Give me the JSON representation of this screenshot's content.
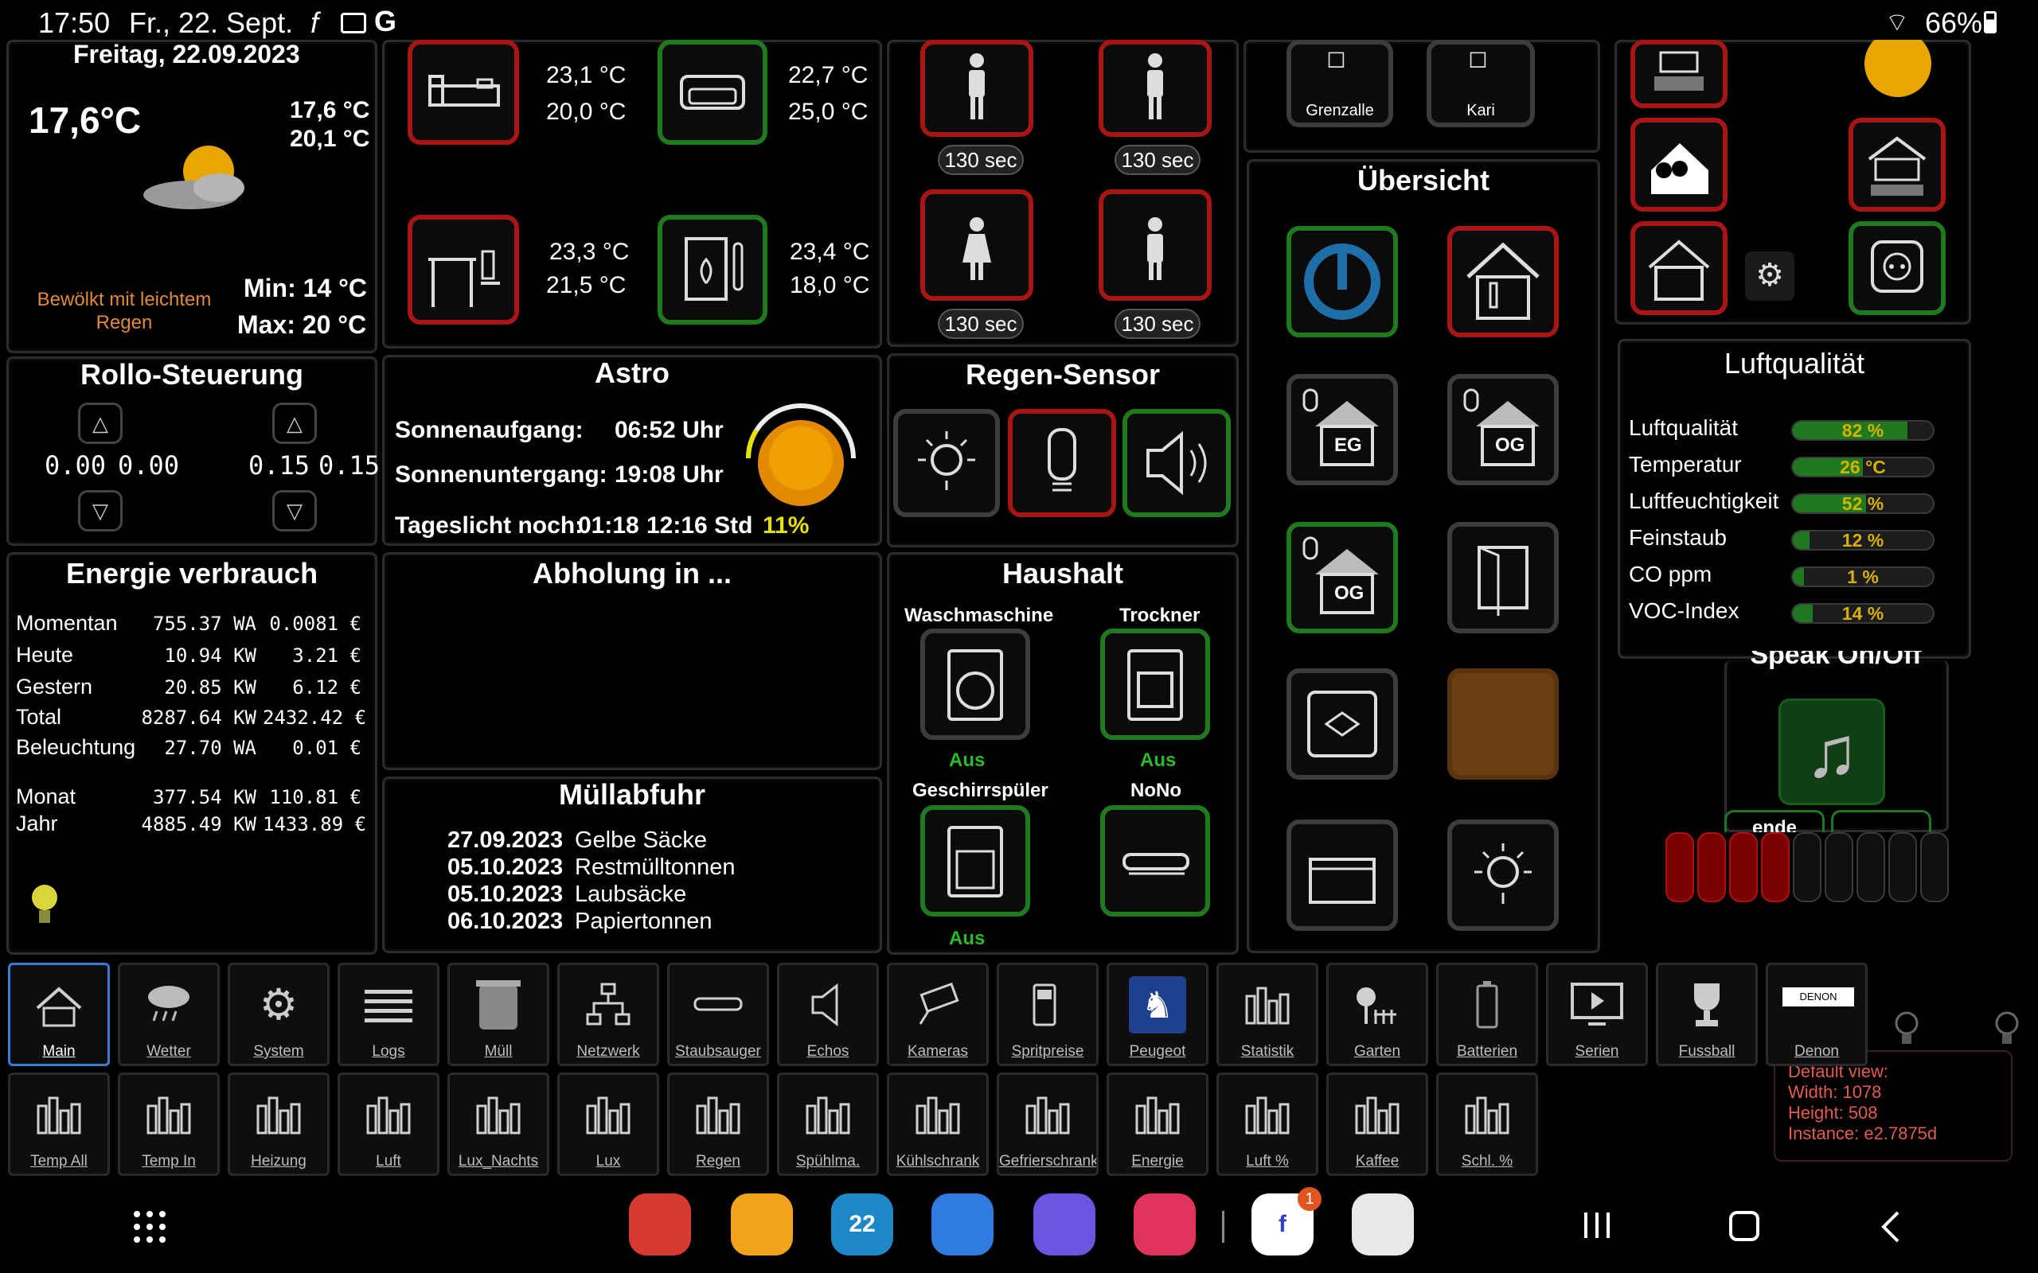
{
  "status_bar": {
    "time": "17:50",
    "date": "Fr., 22. Sept.",
    "battery": "66%",
    "icons": [
      "f-icon",
      "gallery-icon",
      "google-icon"
    ]
  },
  "weather": {
    "date": "Freitag, 22.09.2023",
    "temp_now": "17,6°C",
    "temp_a": "17,6 °C",
    "temp_b": "20,1 °C",
    "desc": "Bewölkt mit leichtem Regen",
    "min": "Min: 14 °C",
    "max": "Max: 20 °C"
  },
  "rooms": [
    {
      "icon": "bed-icon",
      "t1": "23,1 °C",
      "t2": "20,0 °C",
      "status": "red"
    },
    {
      "icon": "sofa-icon",
      "t1": "22,7 °C",
      "t2": "25,0 °C",
      "status": "green"
    },
    {
      "icon": "desk-icon",
      "t1": "23,3 °C",
      "t2": "21,5 °C",
      "status": "red"
    },
    {
      "icon": "heater-icon",
      "t1": "23,4 °C",
      "t2": "18,0 °C",
      "status": "green"
    }
  ],
  "presence": {
    "labels": [
      "130 sec",
      "130 sec",
      "130 sec",
      "130 sec"
    ]
  },
  "messages": {
    "items": [
      "Grenzalle",
      "Kari"
    ]
  },
  "rollo": {
    "title": "Rollo-Steuerung",
    "left": [
      "0.00",
      "0.00"
    ],
    "right": [
      "0.15",
      "0.15"
    ]
  },
  "astro": {
    "title": "Astro",
    "sunrise_label": "Sonnenaufgang:",
    "sunrise": "06:52 Uhr",
    "sunset_label": "Sonnenuntergang:",
    "sunset": "19:08 Uhr",
    "daylight_label": "Tageslicht noch:",
    "daylight": "01:18",
    "daylight_total": "12:16 Std",
    "percent": "11%",
    "sun_progress": 0.11
  },
  "regen": {
    "title": "Regen-Sensor"
  },
  "energie": {
    "title": "Energie verbrauch",
    "rows": [
      {
        "label": "Momentan",
        "v1": "755.37 WA",
        "v2": "0.0081 €"
      },
      {
        "label": "Heute",
        "v1": "10.94 KW",
        "v2": "3.21 €"
      },
      {
        "label": "Gestern",
        "v1": "20.85 KW",
        "v2": "6.12 €"
      },
      {
        "label": "Total",
        "v1": "8287.64 KW",
        "v2": "2432.42 €"
      },
      {
        "label": "Beleuchtung",
        "v1": "27.70 WA",
        "v2": "0.01 €"
      },
      {
        "label": "Monat",
        "v1": "377.54 KW",
        "v2": "110.81 €"
      },
      {
        "label": "Jahr",
        "v1": "4885.49 KW",
        "v2": "1433.89 €"
      }
    ]
  },
  "abholung": {
    "title": "Abholung in ..."
  },
  "muell": {
    "title": "Müllabfuhr",
    "items": [
      {
        "date": "27.09.2023",
        "type": "Gelbe Säcke"
      },
      {
        "date": "05.10.2023",
        "type": "Restmülltonnen"
      },
      {
        "date": "05.10.2023",
        "type": "Laubsäcke"
      },
      {
        "date": "06.10.2023",
        "type": "Papiertonnen"
      }
    ]
  },
  "haushalt": {
    "title": "Haushalt",
    "devices": [
      {
        "name": "Waschmaschine",
        "status": "Aus"
      },
      {
        "name": "Trockner",
        "status": "Aus"
      },
      {
        "name": "Geschirrspüler",
        "status": "Aus"
      },
      {
        "name": "NoNo",
        "status": ""
      }
    ]
  },
  "uebersicht": {
    "title": "Übersicht",
    "labels": {
      "eg": "EG",
      "og": "OG",
      "og2": "OG"
    }
  },
  "luft": {
    "title": "Luftqualität",
    "rows": [
      {
        "label": "Luftqualität",
        "value": "82 %",
        "level": 0.82
      },
      {
        "label": "Temperatur",
        "value": "26 °C",
        "level": 0.5
      },
      {
        "label": "Luftfeuchtigkeit",
        "value": "52 %",
        "level": 0.52
      },
      {
        "label": "Feinstaub",
        "value": "12 %",
        "level": 0.12
      },
      {
        "label": "CO ppm",
        "value": "1 %",
        "level": 0.01
      },
      {
        "label": "VOC-Index",
        "value": "14 %",
        "level": 0.14
      }
    ]
  },
  "speak": {
    "title": "Speak On/Off",
    "tab1": "ende",
    "volume_level": 4,
    "volume_total": 9
  },
  "nav1": [
    {
      "label": "Main",
      "icon": "house-icon"
    },
    {
      "label": "Wetter",
      "icon": "rain-cloud-icon"
    },
    {
      "label": "System",
      "icon": "gears-icon"
    },
    {
      "label": "Logs",
      "icon": "list-icon"
    },
    {
      "label": "Müll",
      "icon": "bin-icon"
    },
    {
      "label": "Netzwerk",
      "icon": "network-icon"
    },
    {
      "label": "Staubsauger",
      "icon": "vacuum-icon"
    },
    {
      "label": "Echos",
      "icon": "speaker-icon"
    },
    {
      "label": "Kameras",
      "icon": "camera-icon"
    },
    {
      "label": "Spritpreise",
      "icon": "fuel-icon"
    },
    {
      "label": "Peugeot",
      "icon": "peugeot-icon"
    },
    {
      "label": "Statistik",
      "icon": "bar-chart-icon"
    },
    {
      "label": "Garten",
      "icon": "garden-icon"
    },
    {
      "label": "Batterien",
      "icon": "battery-icon"
    },
    {
      "label": "Serien",
      "icon": "tv-play-icon"
    },
    {
      "label": "Fussball",
      "icon": "trophy-icon"
    },
    {
      "label": "Denon",
      "icon": "denon-icon",
      "logo_text": "DENON"
    }
  ],
  "nav2": [
    {
      "label": "Temp All"
    },
    {
      "label": "Temp In"
    },
    {
      "label": "Heizung"
    },
    {
      "label": "Luft"
    },
    {
      "label": "Lux_Nachts"
    },
    {
      "label": "Lux"
    },
    {
      "label": "Regen"
    },
    {
      "label": "Spühlma."
    },
    {
      "label": "Kühlschrank"
    },
    {
      "label": "Gefrierschrank"
    },
    {
      "label": "Energie"
    },
    {
      "label": "Luft %"
    },
    {
      "label": "Kaffee"
    },
    {
      "label": "Schl. %"
    }
  ],
  "debug": {
    "line1": "Default view:",
    "line2": "Width: 1078",
    "line3": "Height: 508",
    "line4": "Instance: e2.7875d"
  },
  "dock": {
    "apps": [
      {
        "name": "notes-app",
        "color": "#d63b2f"
      },
      {
        "name": "files-app",
        "color": "#f2a31b"
      },
      {
        "name": "calendar-app",
        "color": "#1e88c7",
        "text": "22"
      },
      {
        "name": "messages-app",
        "color": "#2f7be0"
      },
      {
        "name": "internet-app",
        "color": "#6a55e0"
      },
      {
        "name": "camera-app",
        "color": "#e0345c"
      },
      {
        "name": "fully-app",
        "color": "#ffffff",
        "text": "f",
        "badge": "1"
      },
      {
        "name": "kiosk-app",
        "color": "#e8e8e8"
      }
    ]
  }
}
